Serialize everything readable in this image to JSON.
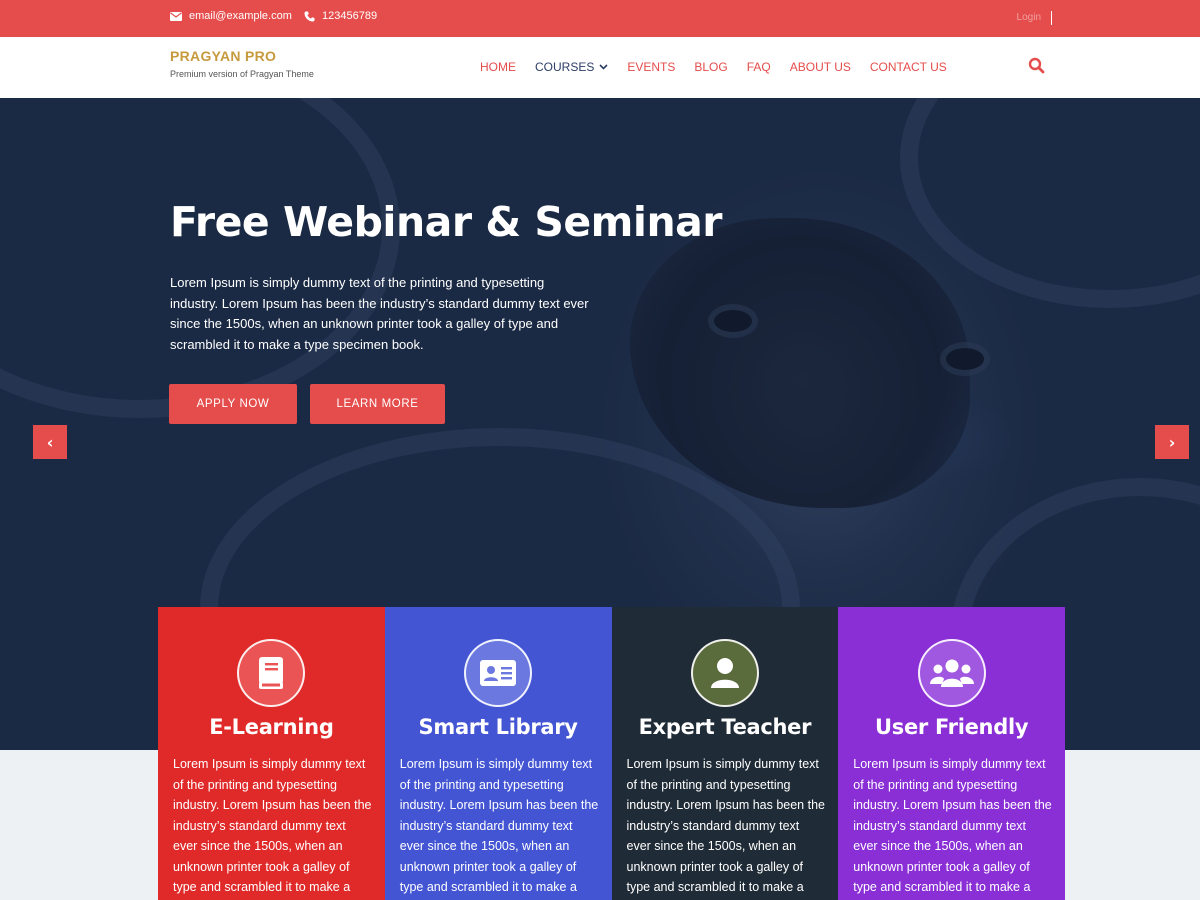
{
  "topbar": {
    "email": "email@example.com",
    "phone": "123456789",
    "login": "Login"
  },
  "brand": {
    "name": "PRAGYAN PRO",
    "tagline": "Premium version of Pragyan Theme"
  },
  "nav": {
    "items": [
      {
        "label": "HOME"
      },
      {
        "label": "COURSES",
        "has_dropdown": true
      },
      {
        "label": "EVENTS"
      },
      {
        "label": "BLOG"
      },
      {
        "label": "FAQ"
      },
      {
        "label": "ABOUT US"
      },
      {
        "label": "CONTACT US"
      }
    ]
  },
  "hero": {
    "title": "Free Webinar & Seminar",
    "text": "Lorem Ipsum is simply dummy text of the printing and typesetting industry. Lorem Ipsum has been the industry’s standard dummy text ever since the 1500s, when an unknown printer took a galley of type and scrambled it to make a type specimen book.",
    "apply_label": "APPLY NOW",
    "learn_label": "LEARN MORE",
    "prev_icon": "‹",
    "next_icon": "›"
  },
  "features": [
    {
      "title": "E-Learning",
      "icon": "book-icon",
      "color": "#e02a2a",
      "text": "Lorem Ipsum is simply dummy text of the printing and typesetting industry. Lorem Ipsum has been the industry’s standard dummy text ever since the 1500s, when an unknown printer took a galley of type and scrambled it to make a type"
    },
    {
      "title": "Smart Library",
      "icon": "id-card-icon",
      "color": "#4455d4",
      "text": "Lorem Ipsum is simply dummy text of the printing and typesetting industry. Lorem Ipsum has been the industry’s standard dummy text ever since the 1500s, when an unknown printer took a galley of type and scrambled it to make a type"
    },
    {
      "title": "Expert Teacher",
      "icon": "user-icon",
      "color": "#1f2b36",
      "text": "Lorem Ipsum is simply dummy text of the printing and typesetting industry. Lorem Ipsum has been the industry’s standard dummy text ever since the 1500s, when an unknown printer took a galley of type and scrambled it to make a type"
    },
    {
      "title": "User Friendly",
      "icon": "users-icon",
      "color": "#8a2ed6",
      "text": "Lorem Ipsum is simply dummy text of the printing and typesetting industry. Lorem Ipsum has been the industry’s standard dummy text ever since the 1500s, when an unknown printer took a galley of type and scrambled it to make a type"
    }
  ],
  "colors": {
    "accent": "#e54c4c",
    "nav_dark": "#2c3e66",
    "brand_gold": "#c79a3e"
  }
}
